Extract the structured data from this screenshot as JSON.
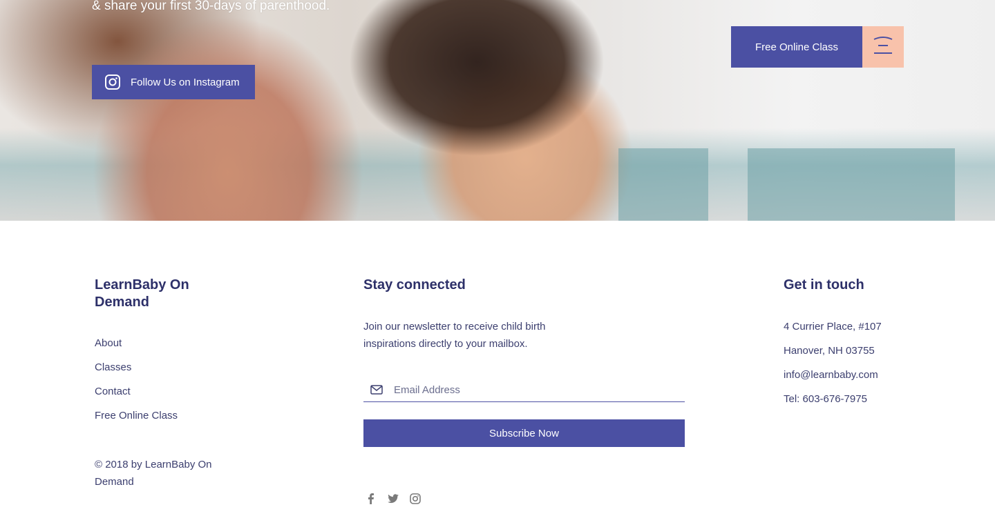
{
  "hero": {
    "caption": "& share your first 30-days of parenthood.",
    "instagram_button": "Follow Us on Instagram",
    "free_class_button": "Free Online Class",
    "menu_icon": "hamburger-wave-icon"
  },
  "footer": {
    "brand": {
      "title_line1": "LearnBaby On",
      "title_line2": "Demand",
      "links": [
        "About",
        "Classes",
        "Contact",
        "Free Online Class"
      ],
      "copyright_line1": "© 2018 by LearnBaby On",
      "copyright_line2": "Demand"
    },
    "newsletter": {
      "title": "Stay connected",
      "description_line1": "Join our newsletter to receive child birth",
      "description_line2": "inspirations directly to your mailbox.",
      "email_placeholder": "Email Address",
      "subscribe_label": "Subscribe Now",
      "social_icons": [
        "facebook-icon",
        "twitter-icon",
        "instagram-icon"
      ]
    },
    "contact": {
      "title": "Get in touch",
      "address_line1": "4 Currier Place, #107",
      "address_line2": "Hanover, NH 03755",
      "email": "info@learnbaby.com",
      "phone": "Tel: 603-676-7975"
    }
  },
  "colors": {
    "primary": "#4b50a3",
    "accent": "#f8c2ab",
    "heading": "#2d3069",
    "text": "#3b3e6e"
  }
}
